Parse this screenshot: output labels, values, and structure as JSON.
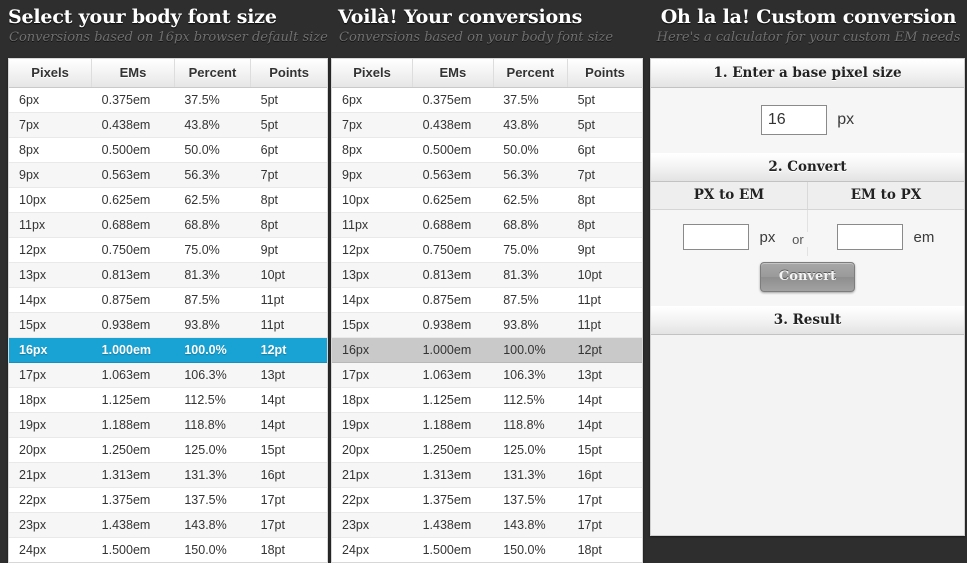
{
  "panels": {
    "left": {
      "title": "Select your body font size",
      "subtitle": "Conversions based on 16px browser default size"
    },
    "middle": {
      "title": "Voilà! Your conversions",
      "subtitle": "Conversions based on your body font size"
    },
    "right": {
      "title": "Oh la la! Custom conversion",
      "subtitle": "Here's a calculator for your custom EM needs"
    }
  },
  "table": {
    "headers": [
      "Pixels",
      "EMs",
      "Percent",
      "Points"
    ],
    "rows": [
      [
        "6px",
        "0.375em",
        "37.5%",
        "5pt"
      ],
      [
        "7px",
        "0.438em",
        "43.8%",
        "5pt"
      ],
      [
        "8px",
        "0.500em",
        "50.0%",
        "6pt"
      ],
      [
        "9px",
        "0.563em",
        "56.3%",
        "7pt"
      ],
      [
        "10px",
        "0.625em",
        "62.5%",
        "8pt"
      ],
      [
        "11px",
        "0.688em",
        "68.8%",
        "8pt"
      ],
      [
        "12px",
        "0.750em",
        "75.0%",
        "9pt"
      ],
      [
        "13px",
        "0.813em",
        "81.3%",
        "10pt"
      ],
      [
        "14px",
        "0.875em",
        "87.5%",
        "11pt"
      ],
      [
        "15px",
        "0.938em",
        "93.8%",
        "11pt"
      ],
      [
        "16px",
        "1.000em",
        "100.0%",
        "12pt"
      ],
      [
        "17px",
        "1.063em",
        "106.3%",
        "13pt"
      ],
      [
        "18px",
        "1.125em",
        "112.5%",
        "14pt"
      ],
      [
        "19px",
        "1.188em",
        "118.8%",
        "14pt"
      ],
      [
        "20px",
        "1.250em",
        "125.0%",
        "15pt"
      ],
      [
        "21px",
        "1.313em",
        "131.3%",
        "16pt"
      ],
      [
        "22px",
        "1.375em",
        "137.5%",
        "17pt"
      ],
      [
        "23px",
        "1.438em",
        "143.8%",
        "17pt"
      ],
      [
        "24px",
        "1.500em",
        "150.0%",
        "18pt"
      ]
    ],
    "selected_index": 10,
    "selected_label": "16px",
    "highlight_color_left": "#19a3d4",
    "highlight_color_middle": "#c9c9c9"
  },
  "calculator": {
    "step1_label": "1. Enter a base pixel size",
    "base_pixel_value": "16",
    "base_pixel_unit": "px",
    "step2_label": "2. Convert",
    "px_to_em_label": "PX to EM",
    "em_to_px_label": "EM to PX",
    "px_input_value": "",
    "px_input_unit": "px",
    "or_label": "or",
    "em_input_value": "",
    "em_input_unit": "em",
    "convert_button": "Convert",
    "step3_label": "3. Result",
    "result_value": ""
  }
}
